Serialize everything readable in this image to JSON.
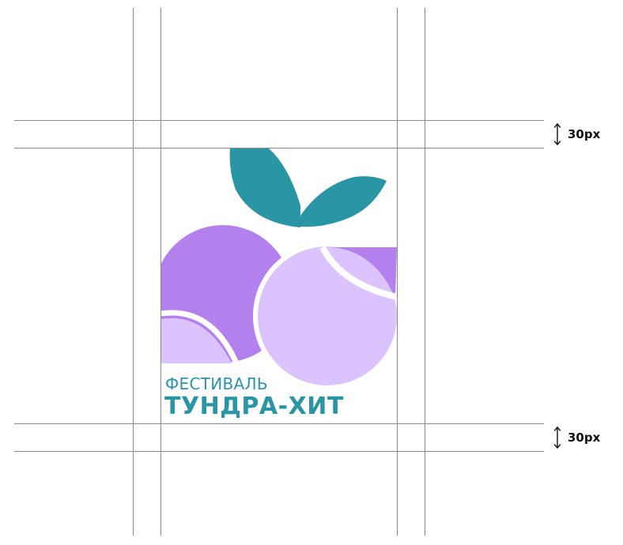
{
  "logo": {
    "line1": "ФЕСТИВАЛЬ",
    "line2": "ТУНДРА-ХИТ",
    "colors": {
      "teal": "#2a95a5",
      "berry_purple": "#b480ee",
      "berry_lilac": "#dbc3fd",
      "background": "#ffffff"
    }
  },
  "guides": {
    "top_spacing_label": "30px",
    "bottom_spacing_label": "30px",
    "arrow_icon": "up-down-arrow-icon",
    "line_color": "#8a8a8a"
  }
}
